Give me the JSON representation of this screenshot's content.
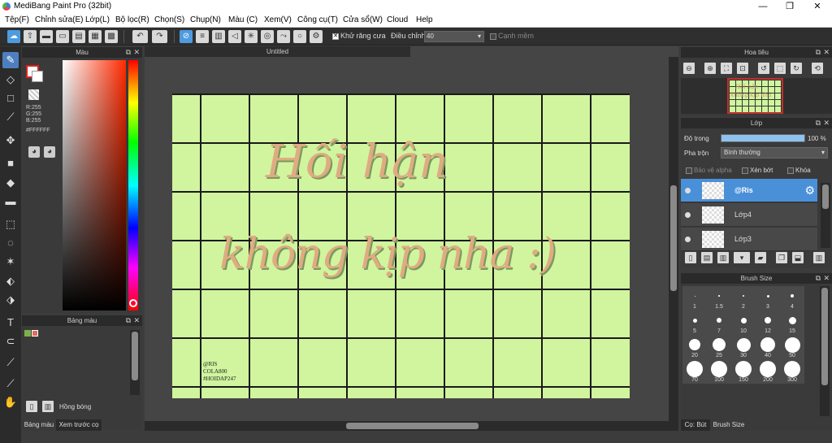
{
  "window": {
    "title": "MediBang Paint Pro (32bit)",
    "minimize": "—",
    "maximize": "❐",
    "close": "✕"
  },
  "menu": [
    "Tệp(F)",
    "Chỉnh sửa(E)",
    "Lớp(L)",
    "Bộ lọc(R)",
    "Chọn(S)",
    "Chụp(N)",
    "Màu (C)",
    "Xem(V)",
    "Công cụ(T)",
    "Cửa sổ(W)",
    "Cloud",
    "Help"
  ],
  "toolbar": {
    "antialias_label": "Khử răng cưa",
    "adjust_label": "Điều chỉnh",
    "adjust_value": "40",
    "edge_label": "Cạnh mềm"
  },
  "color_panel": {
    "title": "Màu",
    "r": "R:255",
    "g": "G:255",
    "b": "B:255",
    "hex": "#FFFFFF"
  },
  "palette_panel": {
    "title": "Bảng màu",
    "shadow_label": "Hồng bóng",
    "tab_palette": "Bảng màu",
    "tab_brush_preview": "Xem trước cọ"
  },
  "document": {
    "tab": "Untitled",
    "line1": "Hối hận",
    "line2": "không kịp nha :)",
    "sig1": "@RIS",
    "sig2": "COLA800",
    "sig3": "#HOIDAP247"
  },
  "navigator": {
    "title": "Hoa tiêu",
    "thumb_line1": "Hối hận",
    "thumb_line2": "không kịp nha"
  },
  "layers_panel": {
    "title": "Lớp",
    "opacity_label": "Độ trong",
    "opacity_value": "100 %",
    "opacity_fraction": 1.0,
    "blend_label": "Pha trộn",
    "blend_value": "Bình thường",
    "protect_alpha": "Bảo vệ alpha",
    "clipping": "Xén bớt",
    "lock": "Khóa",
    "layers": [
      {
        "name": "@Ris",
        "selected": true
      },
      {
        "name": "Lớp4",
        "selected": false
      },
      {
        "name": "Lớp3",
        "selected": false
      }
    ]
  },
  "brush_panel": {
    "title": "Brush Size",
    "sizes": [
      "1",
      "1.5",
      "2",
      "3",
      "4",
      "5",
      "7",
      "10",
      "12",
      "15",
      "20",
      "25",
      "30",
      "40",
      "50",
      "70",
      "100",
      "150",
      "200",
      "300"
    ],
    "tab_brush": "Cọ: Bút",
    "tab_size": "Brush Size"
  },
  "colors": {
    "canvas_bg": "#d0f59e",
    "accent": "#4a90d9",
    "text_fill": "#e0ab82"
  }
}
